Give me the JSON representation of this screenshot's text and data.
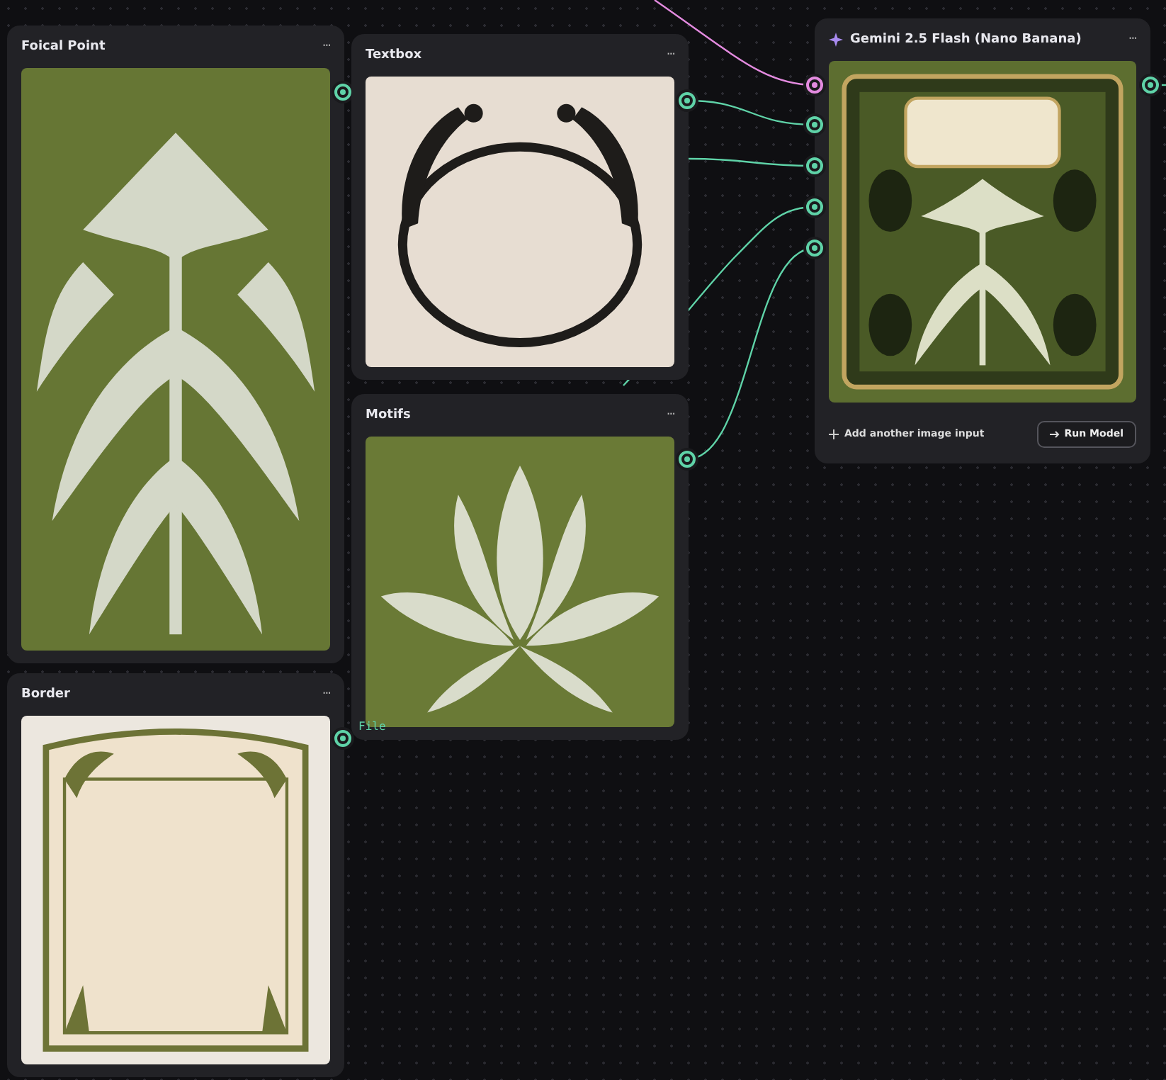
{
  "nodes": [
    {
      "title": "Foical Point",
      "menu": "···",
      "outputs": [
        {
          "color": "#5fd3a8"
        }
      ]
    },
    {
      "title": "Textbox",
      "menu": "···",
      "outputs": [
        {
          "color": "#5fd3a8"
        }
      ]
    },
    {
      "title": "Motifs",
      "menu": "···",
      "outputs": [
        {
          "color": "#5fd3a8"
        }
      ]
    },
    {
      "title": "Border",
      "menu": "···",
      "outputs": [
        {
          "label": "File",
          "color": "#5fd3a8"
        }
      ]
    },
    {
      "kind": "model",
      "title": "Gemini 2.5 Flash (Nano Banana)",
      "menu": "···",
      "inputs": [
        {
          "color": "#e48be0"
        },
        {
          "color": "#5fd3a8"
        },
        {
          "color": "#5fd3a8"
        },
        {
          "color": "#5fd3a8"
        },
        {
          "color": "#5fd3a8"
        }
      ],
      "outputs": [
        {
          "color": "#5fd3a8"
        }
      ],
      "add_input": "Add another image input",
      "run_button": "Run Model"
    }
  ]
}
